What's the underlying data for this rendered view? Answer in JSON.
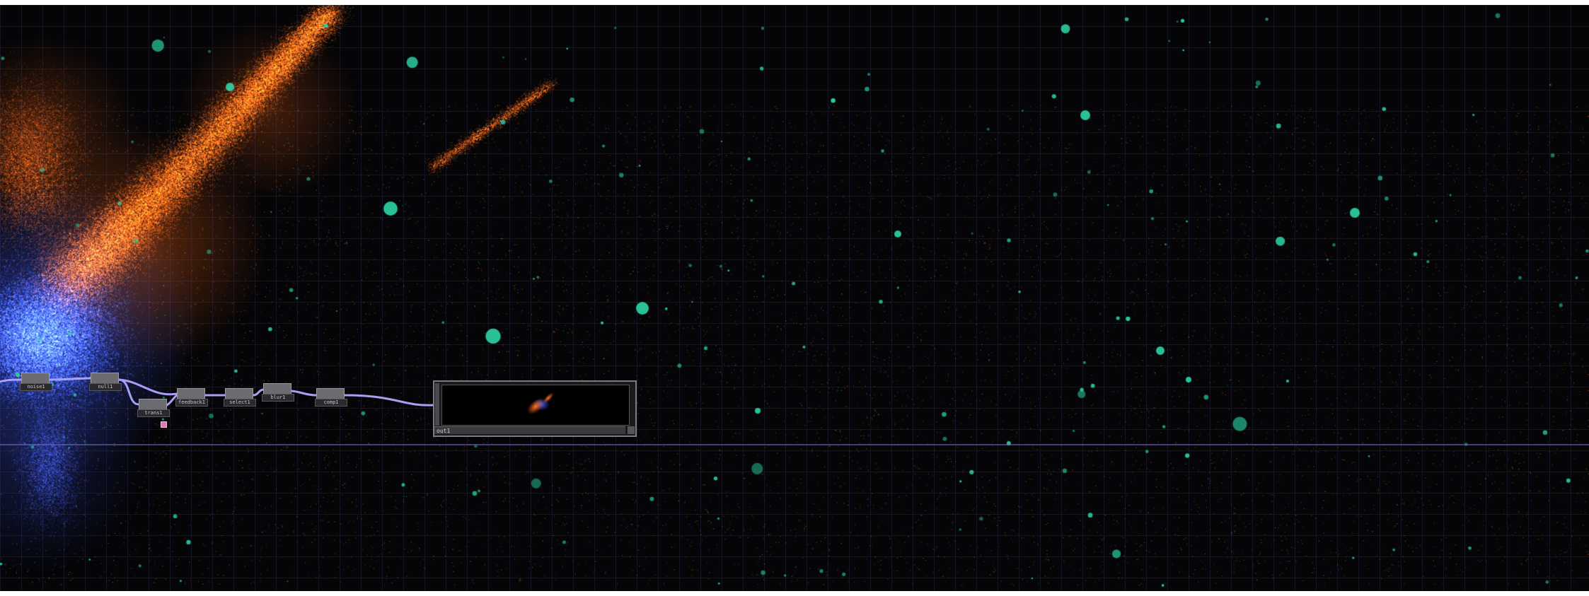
{
  "colors": {
    "background": "#050507",
    "grid": "#2a2a48",
    "wire": "#b4a6ff",
    "particle_orange": "#ff6a1a",
    "particle_blue": "#3b55e6",
    "particle_teal": "#2ed6a8",
    "node_fill": "#6c6c70",
    "flag": "#e07ab0"
  },
  "network": {
    "nodes": [
      {
        "id": "n1",
        "label": "noise1"
      },
      {
        "id": "n2",
        "label": "null1"
      },
      {
        "id": "n3",
        "label": "trans1"
      },
      {
        "id": "n4",
        "label": "feedback1"
      },
      {
        "id": "n5",
        "label": "select1"
      },
      {
        "id": "n6",
        "label": "blur1"
      },
      {
        "id": "n7",
        "label": "comp1"
      }
    ],
    "viewer": {
      "label": "out1"
    }
  }
}
